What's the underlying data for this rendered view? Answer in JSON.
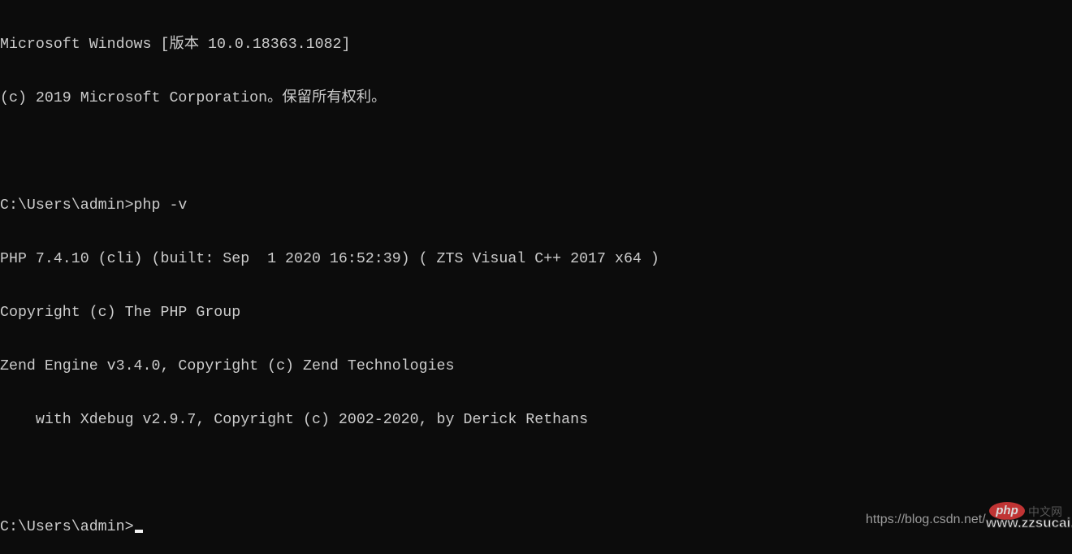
{
  "console": {
    "lines": [
      "Microsoft Windows [版本 10.0.18363.1082]",
      "(c) 2019 Microsoft Corporation。保留所有权利。",
      "",
      "C:\\Users\\admin>php -v",
      "PHP 7.4.10 (cli) (built: Sep  1 2020 16:52:39) ( ZTS Visual C++ 2017 x64 )",
      "Copyright (c) The PHP Group",
      "Zend Engine v3.4.0, Copyright (c) Zend Technologies",
      "    with Xdebug v2.9.7, Copyright (c) 2002-2020, by Derick Rethans",
      "",
      "C:\\Users\\admin>"
    ]
  },
  "watermark": {
    "url": "https://blog.csdn.net/",
    "logo": "php",
    "logo_cn": "中文网",
    "site": "www.zzsucai.com"
  }
}
